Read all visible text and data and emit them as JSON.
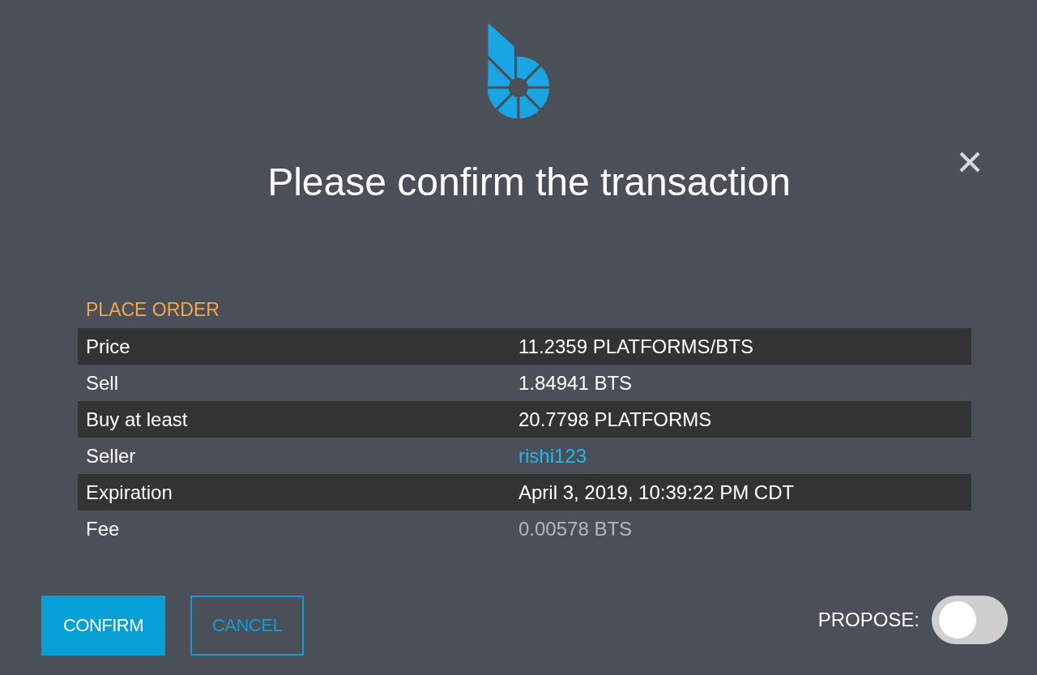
{
  "dialog": {
    "title": "Please confirm the transaction"
  },
  "operation": {
    "heading": "PLACE ORDER",
    "rows": [
      {
        "label": "Price",
        "value": "11.2359 PLATFORMS/BTS",
        "kind": "plain"
      },
      {
        "label": "Sell",
        "value": "1.84941 BTS",
        "kind": "plain"
      },
      {
        "label": "Buy at least",
        "value": "20.7798 PLATFORMS",
        "kind": "plain"
      },
      {
        "label": "Seller",
        "value": "rishi123",
        "kind": "link"
      },
      {
        "label": "Expiration",
        "value": "April 3, 2019, 10:39:22 PM CDT",
        "kind": "plain"
      },
      {
        "label": "Fee",
        "value": "0.00578 BTS",
        "kind": "muted"
      }
    ]
  },
  "actions": [
    {
      "label": "CONFIRM",
      "kind": "primary"
    },
    {
      "label": "CANCEL",
      "kind": "outline"
    }
  ],
  "propose": {
    "label": "PROPOSE:",
    "on": false
  }
}
